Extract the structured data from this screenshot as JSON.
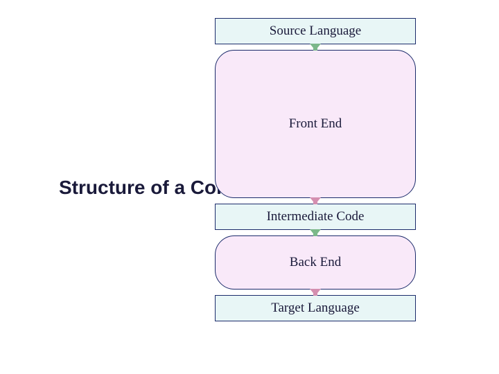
{
  "title": "Structure of a Compiler",
  "flow": {
    "source": "Source Language",
    "front": "Front End",
    "intermediate": "Intermediate Code",
    "back": "Back End",
    "target": "Target Language"
  }
}
